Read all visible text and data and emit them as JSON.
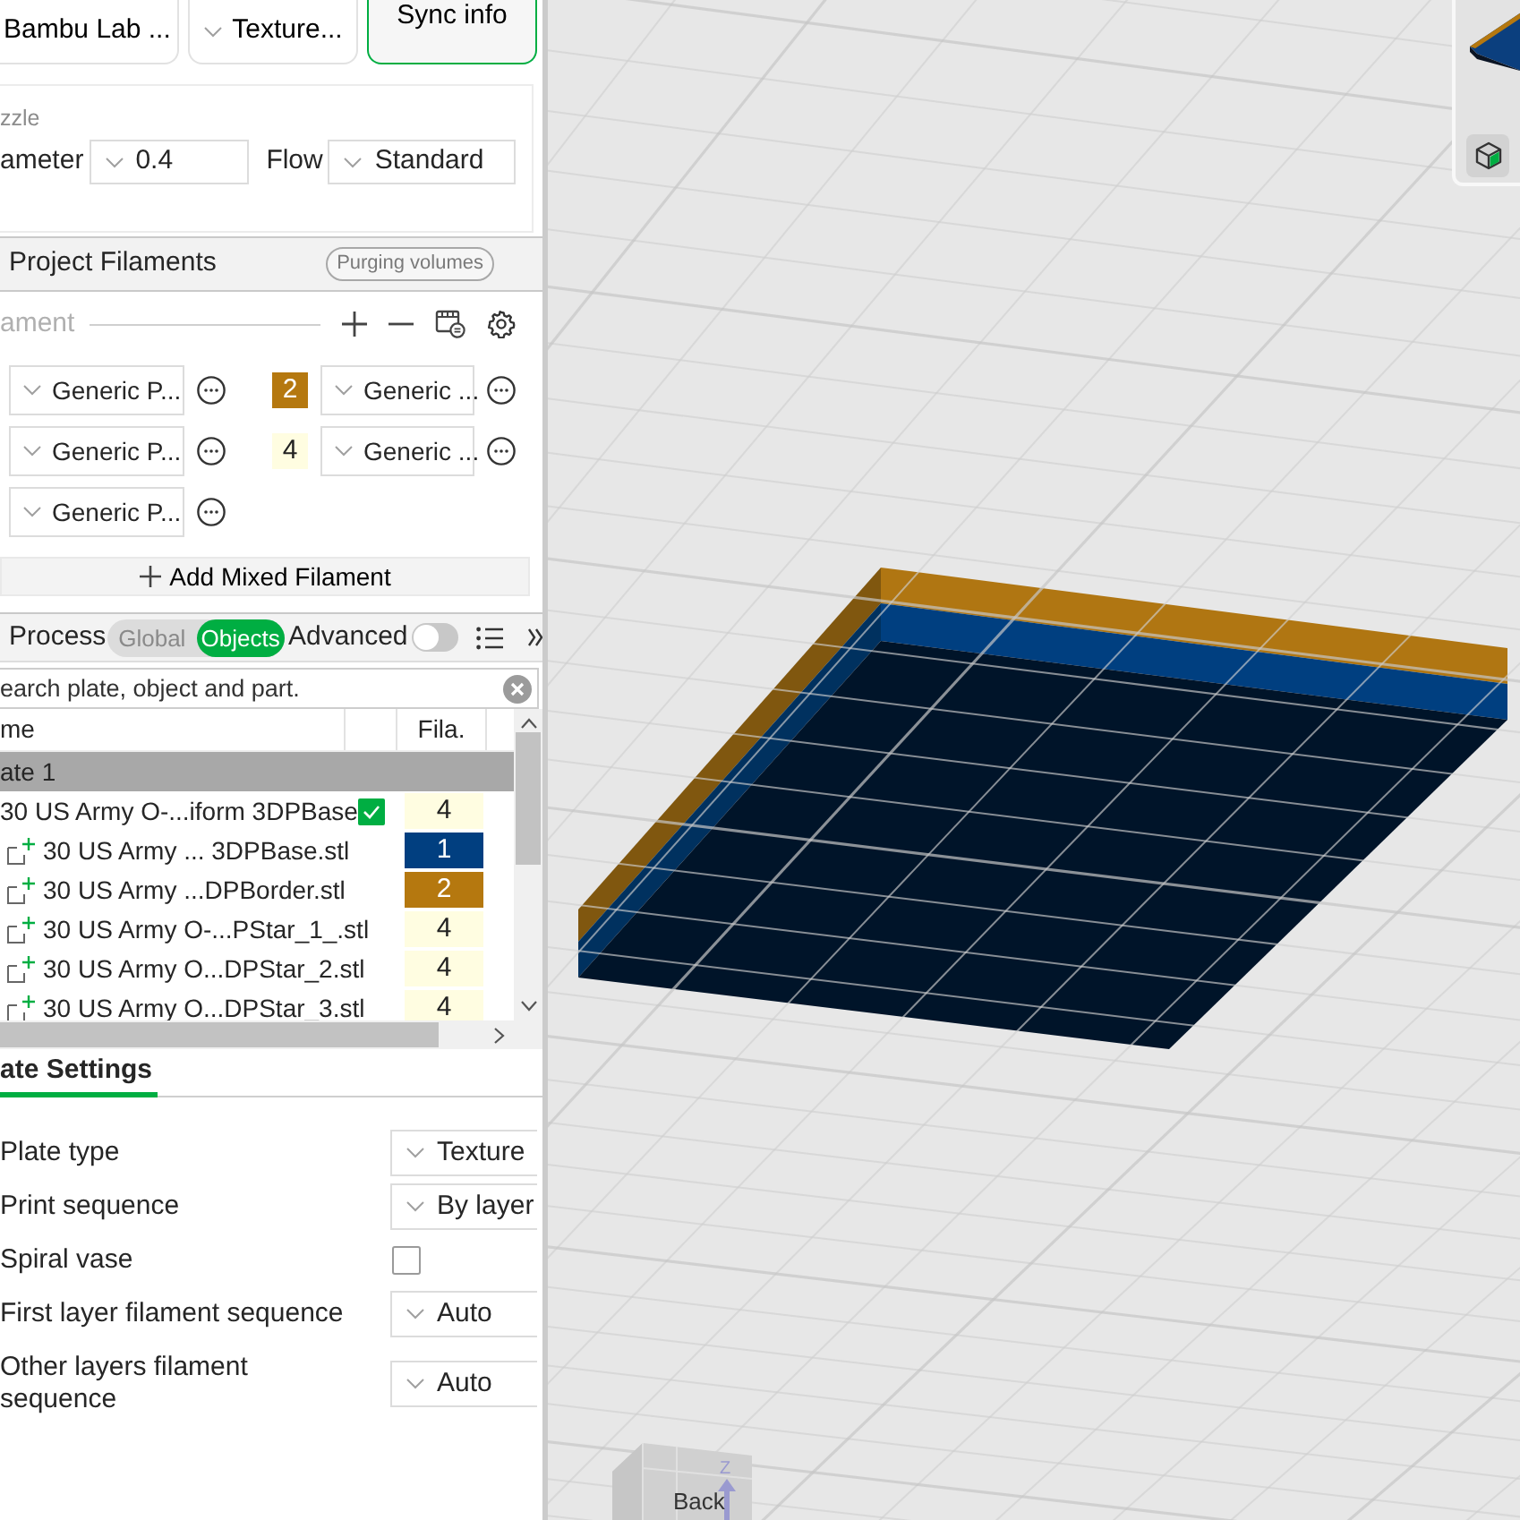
{
  "top_buttons": [
    {
      "label": "Bambu Lab ...",
      "kind": "plain"
    },
    {
      "label": "Texture...",
      "kind": "dropdown"
    },
    {
      "label": "Sync info",
      "kind": "accent"
    }
  ],
  "nozzle": {
    "title": "zzle",
    "fields": [
      {
        "label": "ameter",
        "value": "0.4"
      },
      {
        "label": "Flow",
        "value": "Standard"
      }
    ]
  },
  "project_filaments": {
    "title": "Project Filaments",
    "purge_button": "Purging volumes",
    "list_label": "ament",
    "slots": [
      {
        "name": "Generic P..."
      },
      {
        "number": "2",
        "color": "#b5780f",
        "name": "Generic ..."
      },
      {
        "name": "Generic P..."
      },
      {
        "number": "4",
        "color": "#fffde1",
        "name": "Generic ..."
      },
      {
        "name": "Generic P..."
      }
    ],
    "add_mixed": "Add Mixed Filament"
  },
  "process": {
    "title": "Process",
    "modes": [
      {
        "label": "Global",
        "selected": false
      },
      {
        "label": "Objects",
        "selected": true
      }
    ],
    "advanced": {
      "label": "Advanced",
      "on": false
    }
  },
  "object_list": {
    "search": {
      "placeholder": "earch plate, object and part."
    },
    "columns": {
      "name": "me",
      "filament": "Fila."
    },
    "plates": [
      {
        "name": "ate 1",
        "children": [
          {
            "name": "30 US Army O-...iform 3DPBase",
            "checked": true,
            "filament": "4",
            "color": "#fffde1",
            "children": [
              {
                "name": "30 US Army ... 3DPBase.stl",
                "filament": "1",
                "color": "#013f80"
              },
              {
                "name": "30 US Army ...DPBorder.stl",
                "filament": "2",
                "color": "#b5780f"
              },
              {
                "name": "30 US Army O-...PStar_1_.stl",
                "filament": "4",
                "color": "#fffde1"
              },
              {
                "name": "30 US Army O...DPStar_2.stl",
                "filament": "4",
                "color": "#fffde1"
              },
              {
                "name": "30 US Army O...DPStar_3.stl",
                "filament": "4",
                "color": "#fffde1"
              }
            ]
          }
        ]
      }
    ]
  },
  "plate_settings": {
    "tab": {
      "label": "ate Settings",
      "selected": true
    },
    "rows": [
      {
        "label": "Plate type",
        "kind": "dropdown",
        "value": "Texture"
      },
      {
        "label": "Print sequence",
        "kind": "dropdown",
        "value": "By layer"
      },
      {
        "label": "Spiral vase",
        "kind": "checkbox",
        "checked": false
      },
      {
        "label": "First layer filament sequence",
        "kind": "dropdown",
        "value": "Auto"
      },
      {
        "label": "Other layers filament sequence",
        "kind": "dropdown",
        "value": "Auto"
      }
    ]
  },
  "view_cube": {
    "face": "Back",
    "axis": "Z"
  }
}
